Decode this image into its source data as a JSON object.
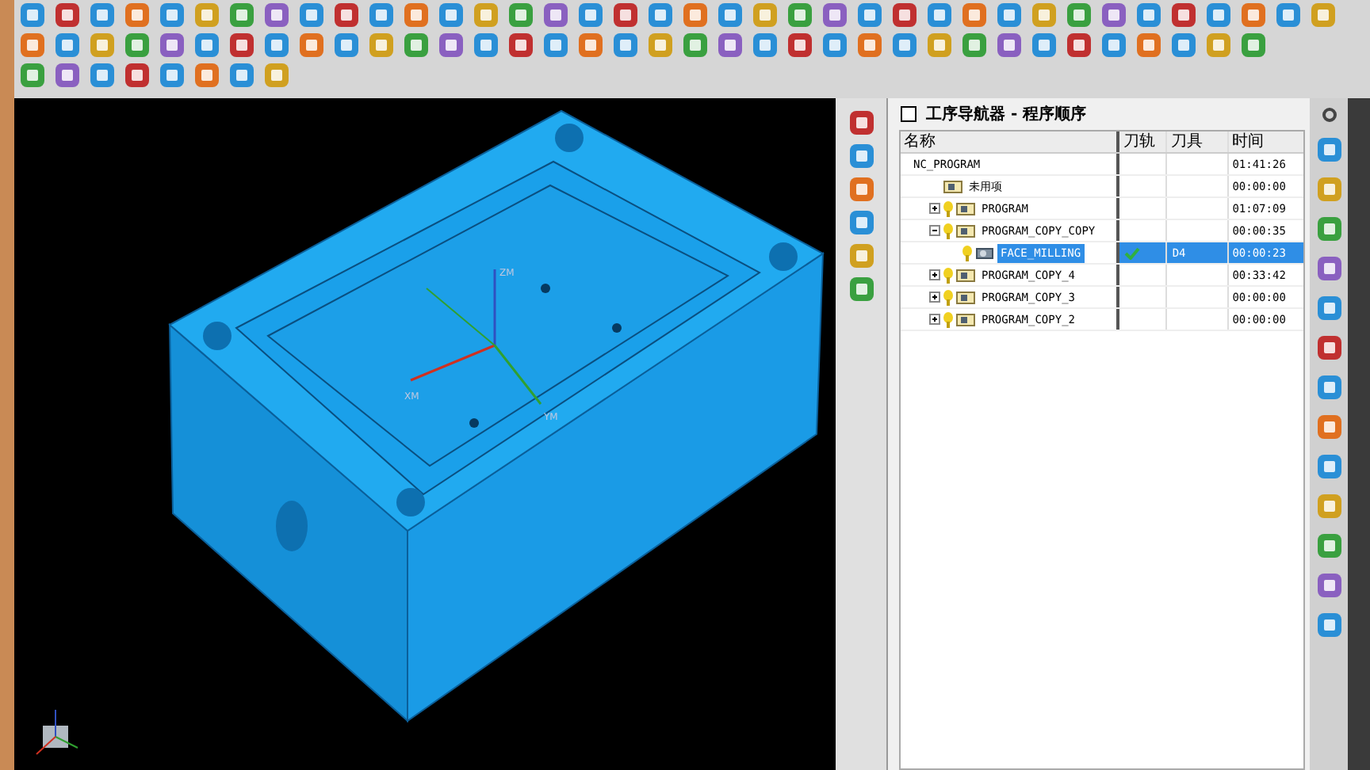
{
  "navigator": {
    "title": "工序导航器 - 程序顺序",
    "columns": [
      "名称",
      "刀轨",
      "刀具",
      "时间"
    ],
    "rows": [
      {
        "kind": "root",
        "name": "NC_PROGRAM",
        "time": "01:41:26",
        "selected": false,
        "children": [
          {
            "kind": "group",
            "name": "未用项",
            "time": "00:00:00",
            "selected": false
          },
          {
            "kind": "program",
            "name": "PROGRAM",
            "time": "01:07:09",
            "expanded": false,
            "selected": false
          },
          {
            "kind": "program",
            "name": "PROGRAM_COPY_COPY",
            "time": "00:00:35",
            "expanded": true,
            "selected": false,
            "children": [
              {
                "kind": "operation",
                "name": "FACE_MILLING",
                "toolpath_ok": true,
                "tool": "D4",
                "time": "00:00:23",
                "selected": true
              }
            ]
          },
          {
            "kind": "program",
            "name": "PROGRAM_COPY_4",
            "time": "00:33:42",
            "expanded": false,
            "selected": false
          },
          {
            "kind": "program",
            "name": "PROGRAM_COPY_3",
            "time": "00:00:00",
            "expanded": false,
            "selected": false
          },
          {
            "kind": "program",
            "name": "PROGRAM_COPY_2",
            "time": "00:00:00",
            "expanded": false,
            "selected": false
          }
        ]
      }
    ]
  },
  "viewport": {
    "axes": [
      "ZM",
      "XM",
      "YM"
    ]
  }
}
